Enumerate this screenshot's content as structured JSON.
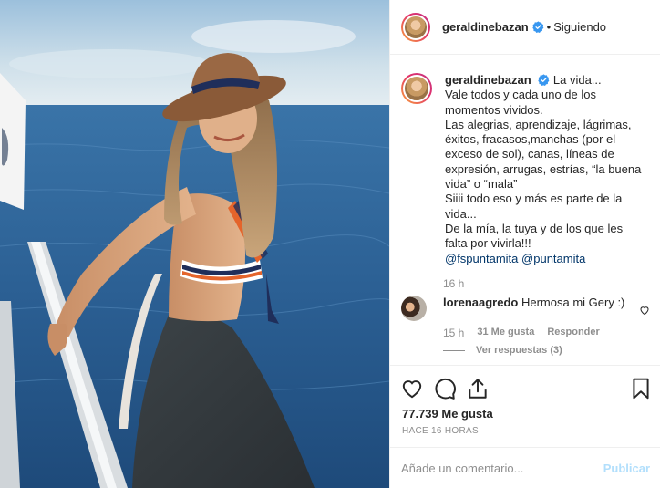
{
  "post": {
    "username": "geraldinebazan",
    "verified": true,
    "follow_separator": "•",
    "follow_status": "Siguiendo"
  },
  "caption": {
    "username": "geraldinebazan",
    "lines": [
      "La vida...",
      "Vale todos y cada uno de los momentos vividos.",
      "Las alegrias, aprendizaje, lágrimas, éxitos, fracasos,manchas (por el exceso de sol), canas, líneas de expresión, arrugas, estrías, “la buena vida” o “mala”",
      "Siiii todo eso y más es parte de la vida...",
      "De la mía, la tuya y de los que les falta por vivirla!!!"
    ],
    "mentions": [
      "@fspuntamita",
      "@puntamita"
    ],
    "time": "16 h"
  },
  "comment": {
    "username": "lorenaagredo",
    "text": "Hermosa mi Gery :)",
    "time": "15 h",
    "likes": "31 Me gusta",
    "reply_label": "Responder",
    "view_replies": "Ver respuestas (3)"
  },
  "actions": {
    "like_icon": "heart-icon",
    "comment_icon": "comment-icon",
    "share_icon": "share-icon",
    "save_icon": "bookmark-icon"
  },
  "stats": {
    "likes": "77.739 Me gusta",
    "timestamp": "HACE 16 HORAS"
  },
  "add_comment": {
    "placeholder": "Añade un comentario...",
    "publish_label": "Publicar"
  },
  "colors": {
    "verified_blue": "#3897f0",
    "mention_blue": "#003569",
    "muted_gray": "#8e8e8e",
    "publish_disabled": "#b2dffc"
  }
}
